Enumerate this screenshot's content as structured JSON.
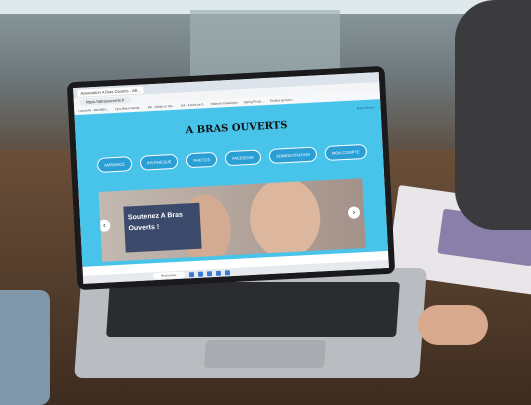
{
  "browser": {
    "tab_title": "Association A Bras Ouverts - AB...",
    "url": "https://abrasouverts.fr",
    "bookmarks": [
      "Lavanche - ROUBEX...",
      "Lynx Bleue Rental...",
      "Bio - Wallas et Ste...",
      "Sol - Fonds de F...",
      "Maisons Classiques",
      "Spring Produ...",
      "Feuilles persons..."
    ]
  },
  "site": {
    "logo": "A BRAS OUVERTS",
    "user_link": "Nom Prénom",
    "nav": [
      "AMBIANCE",
      "INVITHEQUE",
      "PHOTOS",
      "FACEBOOK",
      "ADMINISTRATION",
      "MON COMPTE"
    ],
    "hero_text": "Soutenez A Bras Ouverts !"
  },
  "taskbar": {
    "search_placeholder": "Rechercher"
  }
}
